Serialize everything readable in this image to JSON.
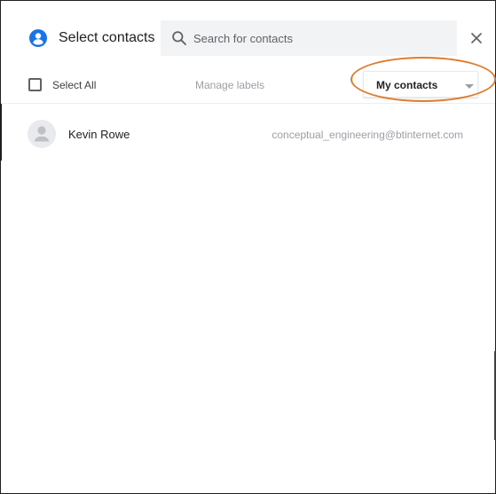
{
  "header": {
    "title": "Select contacts",
    "search_placeholder": "Search for contacts",
    "search_value": "",
    "icons": {
      "title": "person-icon",
      "search": "search-icon",
      "close": "close-icon"
    }
  },
  "toolbar": {
    "select_all_label": "Select All",
    "select_all_checked": false,
    "manage_labels": "Manage labels",
    "contacts_dropdown": {
      "selected": "My contacts"
    }
  },
  "contacts": [
    {
      "name": "Kevin Rowe",
      "email": "conceptual_engineering@btinternet.com",
      "avatar_icon": "default-avatar-icon"
    }
  ],
  "colors": {
    "accent": "#1a73e8",
    "highlight": "#e07b2c",
    "search_background": "#f1f3f4",
    "muted_text": "#9aa0a6"
  }
}
